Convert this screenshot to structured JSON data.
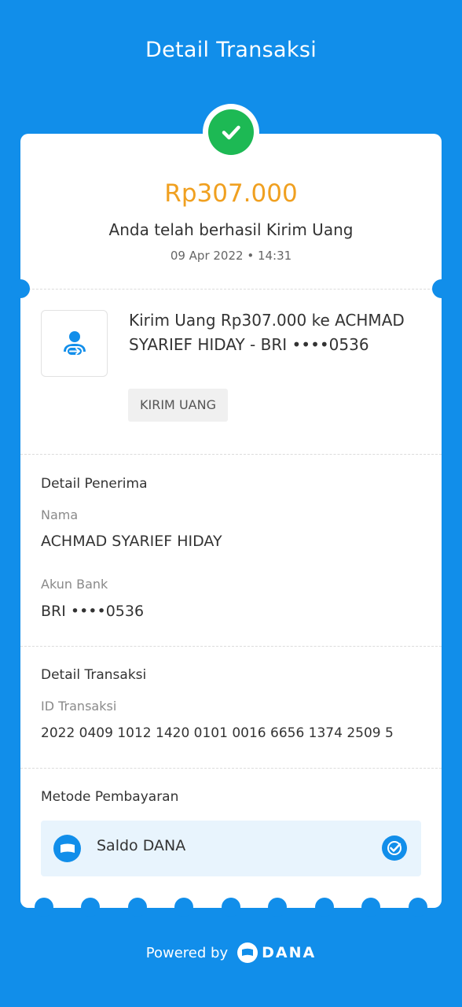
{
  "header": {
    "title": "Detail Transaksi"
  },
  "summary": {
    "amount": "Rp307.000",
    "status": "Anda telah berhasil Kirim Uang",
    "datetime": "09 Apr 2022 • 14:31"
  },
  "transaction": {
    "description": "Kirim Uang Rp307.000 ke ACHMAD SYARIEF HIDAY - BRI ••••0536",
    "badge": "KIRIM UANG",
    "icon": "send-money-icon"
  },
  "recipient": {
    "section_title": "Detail Penerima",
    "name_label": "Nama",
    "name_value": "ACHMAD SYARIEF HIDAY",
    "account_label": "Akun Bank",
    "account_value": "BRI ••••0536"
  },
  "details": {
    "section_title": "Detail Transaksi",
    "id_label": "ID Transaksi",
    "id_value": "2022 0409 1012 1420 0101 0016 6656 1374 2509 5"
  },
  "payment": {
    "section_title": "Metode Pembayaran",
    "method": "Saldo DANA",
    "icon": "wallet-icon",
    "selected_icon": "check-badge-icon"
  },
  "footer": {
    "powered_label": "Powered by",
    "brand": "DANA"
  },
  "colors": {
    "background": "#118EEA",
    "amount": "#F0A020",
    "success": "#1DB954",
    "payment_box": "#E8F4FD"
  }
}
